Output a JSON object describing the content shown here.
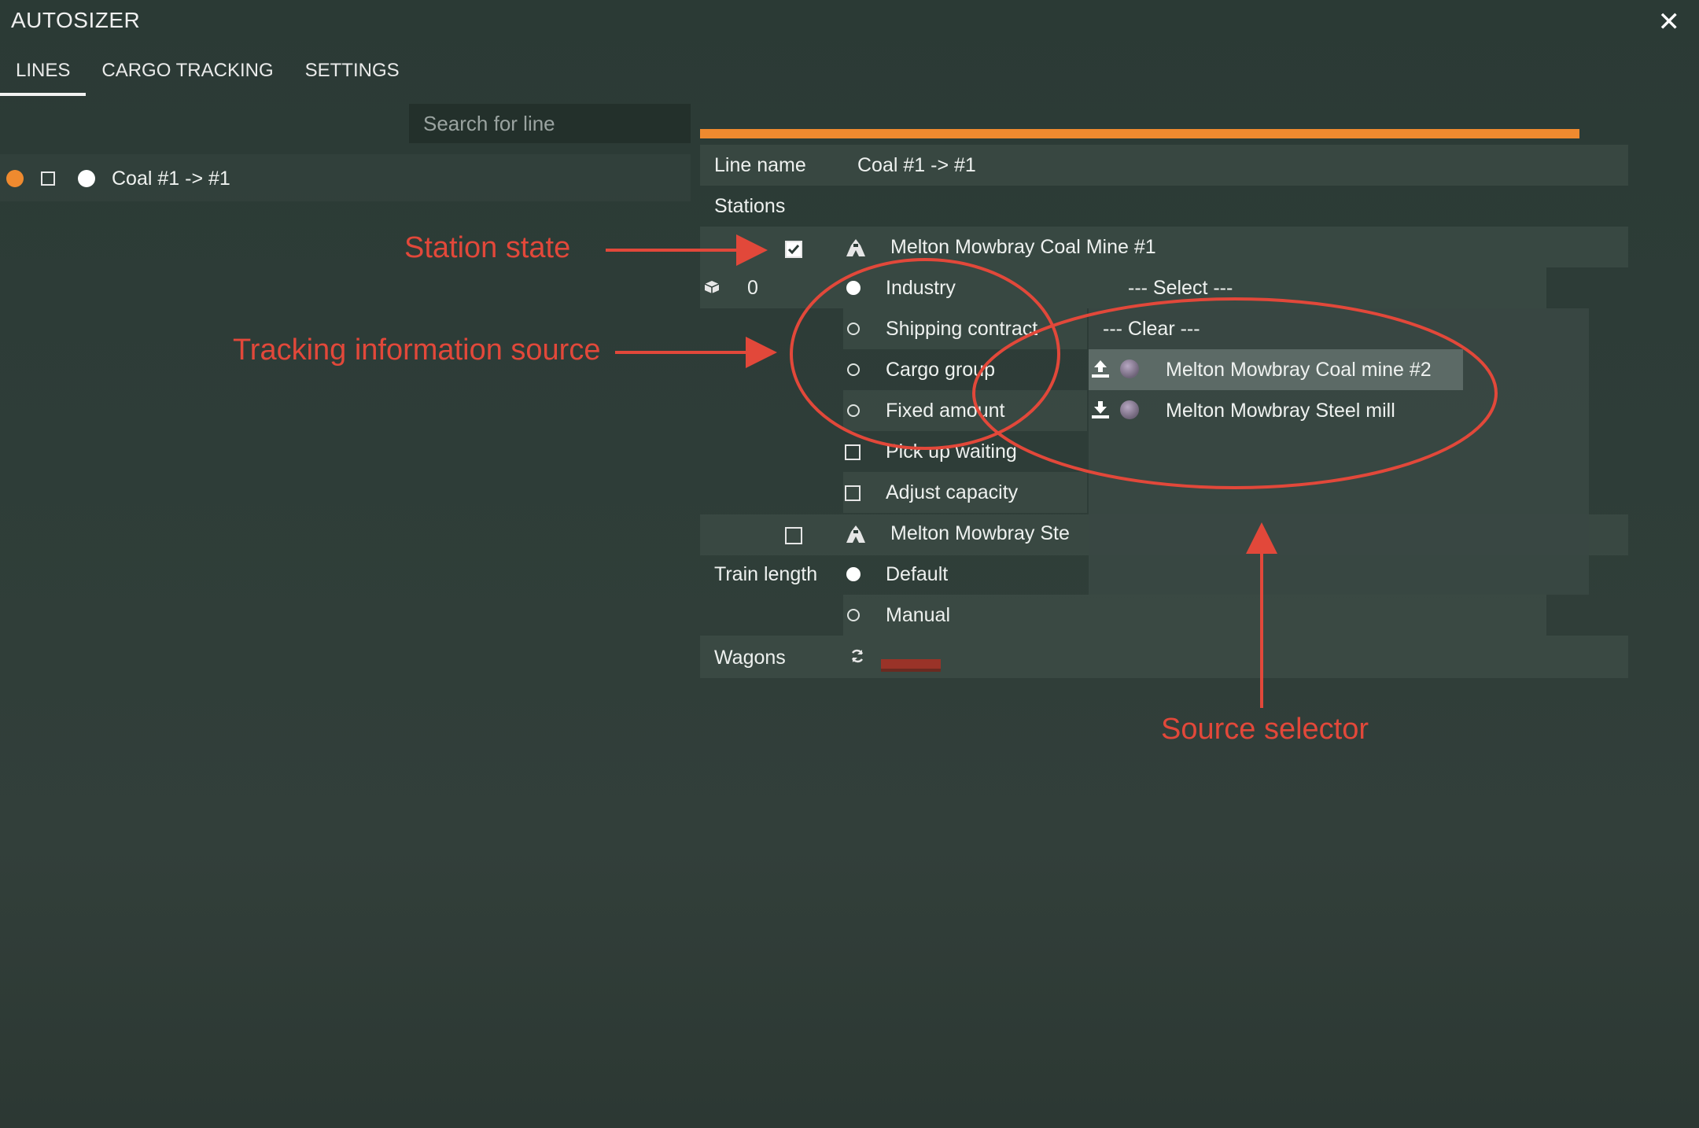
{
  "window": {
    "title": "AUTOSIZER",
    "close_glyph": "✕"
  },
  "tabs": [
    {
      "label": "LINES",
      "active": true
    },
    {
      "label": "CARGO TRACKING",
      "active": false
    },
    {
      "label": "SETTINGS",
      "active": false
    }
  ],
  "search": {
    "placeholder": "Search for line"
  },
  "lines_list": [
    {
      "name": "Coal #1 -> #1",
      "color": "#ef8a2f"
    }
  ],
  "details": {
    "line_name_label": "Line name",
    "line_name_value": "Coal #1 -> #1",
    "line_color": "#ef8a2f",
    "stations_label": "Stations",
    "stations": [
      {
        "name": "Melton Mowbray Coal Mine #1",
        "enabled": true
      },
      {
        "name": "Melton Mowbray Ste",
        "enabled": false
      }
    ],
    "cargo_amount": "0",
    "source_options": [
      {
        "label": "Industry",
        "selected": true
      },
      {
        "label": "Shipping contract",
        "selected": false
      },
      {
        "label": "Cargo group",
        "selected": false
      },
      {
        "label": "Fixed amount",
        "selected": false
      }
    ],
    "pick_up_waiting_label": "Pick up waiting",
    "adjust_capacity_label": "Adjust capacity",
    "select_placeholder": "--- Select ---",
    "train_length_label": "Train length",
    "train_length_options": [
      {
        "label": "Default",
        "selected": true
      },
      {
        "label": "Manual",
        "selected": false
      }
    ],
    "wagons_label": "Wagons"
  },
  "source_dropdown": {
    "clear_label": "--- Clear ---",
    "items": [
      {
        "label": "Melton Mowbray Coal mine #2",
        "direction": "upload-icon",
        "highlighted": true
      },
      {
        "label": "Melton Mowbray Steel mill",
        "direction": "download-icon",
        "highlighted": false
      }
    ]
  },
  "annotations": {
    "station_state": "Station state",
    "tracking_source": "Tracking information source",
    "source_selector": "Source selector",
    "color": "#e2483a"
  }
}
